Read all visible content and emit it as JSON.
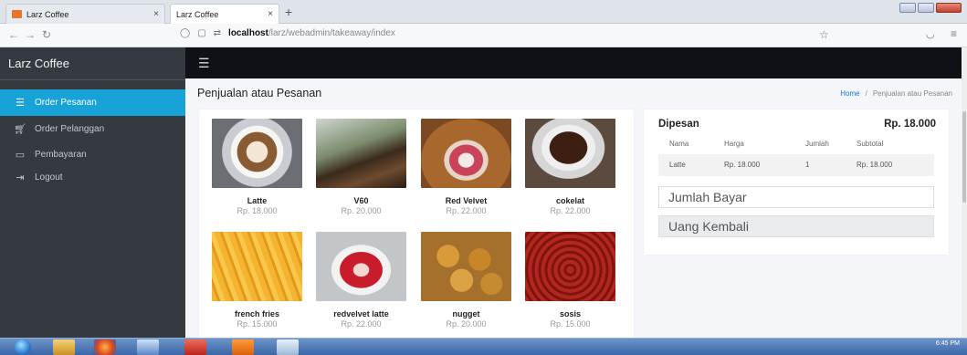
{
  "browser": {
    "tabs": [
      {
        "title": "Larz Coffee",
        "close": "×"
      },
      {
        "title": "Larz Coffee",
        "close": "×"
      }
    ],
    "new_tab": "+",
    "url_host": "localhost",
    "url_path": "/larz/webadmin/takeaway/index"
  },
  "app": {
    "brand": "Larz Coffee",
    "sidebar": [
      {
        "label": "Order Pesanan",
        "icon": "layers-icon",
        "active": true
      },
      {
        "label": "Order Pelanggan",
        "icon": "cart-icon",
        "active": false
      },
      {
        "label": "Pembayaran",
        "icon": "monitor-icon",
        "active": false
      },
      {
        "label": "Logout",
        "icon": "logout-icon",
        "active": false
      }
    ]
  },
  "page": {
    "title": "Penjualan atau Pesanan",
    "breadcrumb": {
      "home": "Home",
      "separator": "/",
      "current": "Penjualan atau Pesanan"
    }
  },
  "products": [
    {
      "name": "Latte",
      "price": "Rp. 18.000"
    },
    {
      "name": "V60",
      "price": "Rp. 20.000"
    },
    {
      "name": "Red Velvet",
      "price": "Rp. 22.000"
    },
    {
      "name": "cokelat",
      "price": "Rp. 22.000"
    },
    {
      "name": "french fries",
      "price": "Rp. 15.000"
    },
    {
      "name": "redvelvet latte",
      "price": "Rp. 22.000"
    },
    {
      "name": "nugget",
      "price": "Rp. 20.000"
    },
    {
      "name": "sosis",
      "price": "Rp. 15.000"
    }
  ],
  "order": {
    "title": "Dipesan",
    "total": "Rp. 18.000",
    "columns": [
      "Nama",
      "Harga",
      "Jumlah",
      "Subtotal"
    ],
    "rows": [
      [
        "Latte",
        "Rp. 18.000",
        "1",
        "Rp. 18.000"
      ]
    ],
    "jumlah_bayar_placeholder": "Jumlah Bayar",
    "uang_kembali_placeholder": "Uang Kembali"
  },
  "taskbar": {
    "clock": "6:45 PM"
  },
  "colors": {
    "sidebar_bg": "#343a40",
    "active_item": "#17a2d8",
    "topbar_bg": "#0f1116"
  }
}
